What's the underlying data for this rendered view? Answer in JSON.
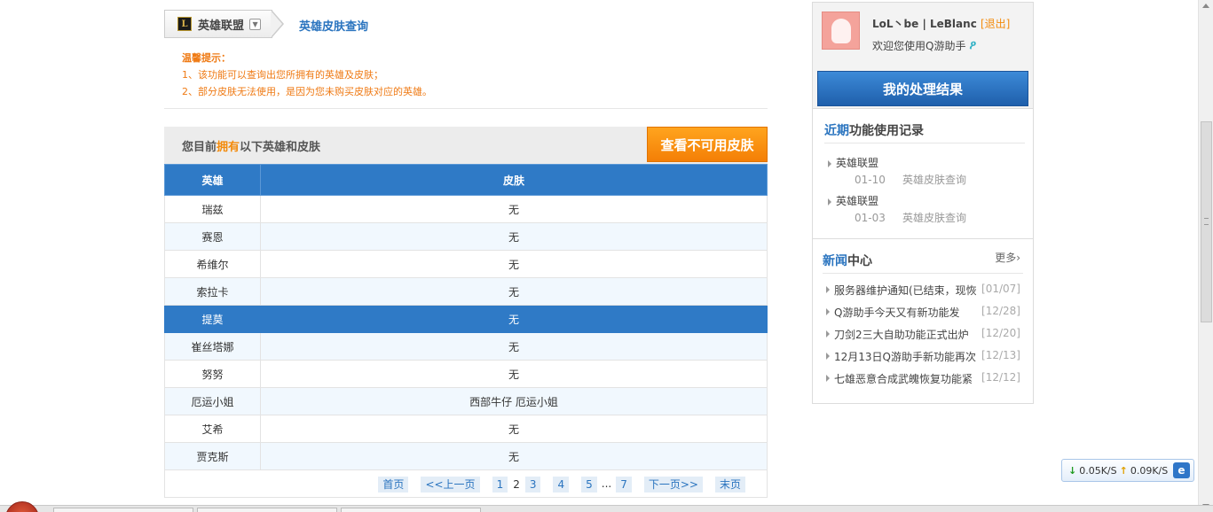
{
  "breadcrumb": {
    "game_icon_text": "L",
    "game_label": "英雄联盟",
    "current": "英雄皮肤查询"
  },
  "tips": {
    "title": "温馨提示：",
    "lines": [
      "1、该功能可以查询出您所拥有的英雄及皮肤；",
      "2、部分皮肤无法使用，是因为您未购买皮肤对应的英雄。"
    ]
  },
  "owned": {
    "prefix": "您目前",
    "highlight": "拥有",
    "suffix": "以下英雄和皮肤",
    "unavailable_button": "查看不可用皮肤"
  },
  "table": {
    "headers": [
      "英雄",
      "皮肤"
    ],
    "rows": [
      {
        "hero": "瑞兹",
        "skin": "无"
      },
      {
        "hero": "赛恩",
        "skin": "无"
      },
      {
        "hero": "希维尔",
        "skin": "无"
      },
      {
        "hero": "索拉卡",
        "skin": "无"
      },
      {
        "hero": "提莫",
        "skin": "无"
      },
      {
        "hero": "崔丝塔娜",
        "skin": "无"
      },
      {
        "hero": "努努",
        "skin": "无"
      },
      {
        "hero": "厄运小姐",
        "skin": "西部牛仔 厄运小姐"
      },
      {
        "hero": "艾希",
        "skin": "无"
      },
      {
        "hero": "贾克斯",
        "skin": "无"
      }
    ],
    "selected_row_index": 4
  },
  "pager": {
    "first": "首页",
    "prev": "<<上一页",
    "pages": [
      "1",
      "2",
      "3",
      "4",
      "5"
    ],
    "current": "2",
    "dots": "...",
    "last_page": "7",
    "next": "下一页>>",
    "last": "末页"
  },
  "user": {
    "name": "LoL丶be | LeBlanc",
    "logout": "[退出]",
    "welcome": "欢迎您使用Q游助手",
    "result_button": "我的处理结果"
  },
  "recent": {
    "title_highlight": "近期",
    "title_rest": "功能使用记录",
    "items": [
      {
        "game": "英雄联盟",
        "date": "01-10",
        "feature": "英雄皮肤查询"
      },
      {
        "game": "英雄联盟",
        "date": "01-03",
        "feature": "英雄皮肤查询"
      }
    ]
  },
  "news": {
    "title_highlight": "新闻",
    "title_rest": "中心",
    "more": "更多›",
    "items": [
      {
        "title": "服务器维护通知(已结束，现恢",
        "date": "[01/07]"
      },
      {
        "title": "Q游助手今天又有新功能发",
        "date": "[12/28]"
      },
      {
        "title": "刀剑2三大自助功能正式出炉",
        "date": "[12/20]"
      },
      {
        "title": "12月13日Q游助手新功能再次",
        "date": "[12/13]"
      },
      {
        "title": "七雄恶意合成武魄恢复功能紧",
        "date": "[12/12]"
      }
    ]
  },
  "speed": {
    "down": "0.05K/S",
    "up": "0.09K/S"
  },
  "colors": {
    "accent_blue": "#2f7ac6",
    "accent_orange": "#f38b0c",
    "tip_orange": "#ef7a14"
  }
}
